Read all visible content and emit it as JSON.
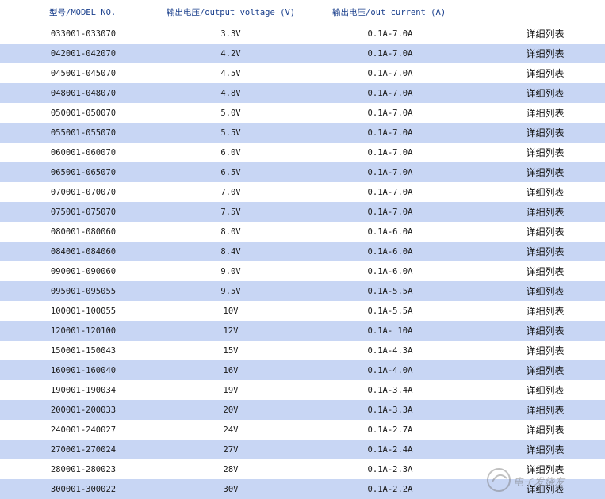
{
  "headers": {
    "model": "型号/MODEL NO.",
    "voltage": "输出电压/output voltage (V)",
    "current": "输出电压/out current (A)",
    "detail": ""
  },
  "rows": [
    {
      "model": "033001-033070",
      "voltage": "3.3V",
      "current": "0.1A-7.0A",
      "detail": "详细列表"
    },
    {
      "model": "042001-042070",
      "voltage": "4.2V",
      "current": "0.1A-7.0A",
      "detail": "详细列表"
    },
    {
      "model": "045001-045070",
      "voltage": "4.5V",
      "current": "0.1A-7.0A",
      "detail": "详细列表"
    },
    {
      "model": "048001-048070",
      "voltage": "4.8V",
      "current": "0.1A-7.0A",
      "detail": "详细列表"
    },
    {
      "model": "050001-050070",
      "voltage": "5.0V",
      "current": "0.1A-7.0A",
      "detail": "详细列表"
    },
    {
      "model": "055001-055070",
      "voltage": "5.5V",
      "current": "0.1A-7.0A",
      "detail": "详细列表"
    },
    {
      "model": "060001-060070",
      "voltage": "6.0V",
      "current": "0.1A-7.0A",
      "detail": "详细列表"
    },
    {
      "model": "065001-065070",
      "voltage": "6.5V",
      "current": "0.1A-7.0A",
      "detail": "详细列表"
    },
    {
      "model": "070001-070070",
      "voltage": "7.0V",
      "current": "0.1A-7.0A",
      "detail": "详细列表"
    },
    {
      "model": "075001-075070",
      "voltage": "7.5V",
      "current": "0.1A-7.0A",
      "detail": "详细列表"
    },
    {
      "model": "080001-080060",
      "voltage": "8.0V",
      "current": "0.1A-6.0A",
      "detail": "详细列表"
    },
    {
      "model": "084001-084060",
      "voltage": "8.4V",
      "current": "0.1A-6.0A",
      "detail": "详细列表"
    },
    {
      "model": "090001-090060",
      "voltage": "9.0V",
      "current": "0.1A-6.0A",
      "detail": "详细列表"
    },
    {
      "model": "095001-095055",
      "voltage": "9.5V",
      "current": "0.1A-5.5A",
      "detail": "详细列表"
    },
    {
      "model": "100001-100055",
      "voltage": "10V",
      "current": "0.1A-5.5A",
      "detail": "详细列表"
    },
    {
      "model": "120001-120100",
      "voltage": "12V",
      "current": "0.1A- 10A",
      "detail": "详细列表"
    },
    {
      "model": "150001-150043",
      "voltage": "15V",
      "current": "0.1A-4.3A",
      "detail": "详细列表"
    },
    {
      "model": "160001-160040",
      "voltage": "16V",
      "current": "0.1A-4.0A",
      "detail": "详细列表"
    },
    {
      "model": "190001-190034",
      "voltage": "19V",
      "current": "0.1A-3.4A",
      "detail": "详细列表"
    },
    {
      "model": "200001-200033",
      "voltage": "20V",
      "current": "0.1A-3.3A",
      "detail": "详细列表"
    },
    {
      "model": "240001-240027",
      "voltage": "24V",
      "current": "0.1A-2.7A",
      "detail": "详细列表"
    },
    {
      "model": "270001-270024",
      "voltage": "27V",
      "current": "0.1A-2.4A",
      "detail": "详细列表"
    },
    {
      "model": "280001-280023",
      "voltage": "28V",
      "current": "0.1A-2.3A",
      "detail": "详细列表"
    },
    {
      "model": "300001-300022",
      "voltage": "30V",
      "current": "0.1A-2.2A",
      "detail": "详细列表"
    }
  ],
  "watermark": {
    "text": "电子发烧友",
    "icon": "elecfans-logo-icon"
  }
}
